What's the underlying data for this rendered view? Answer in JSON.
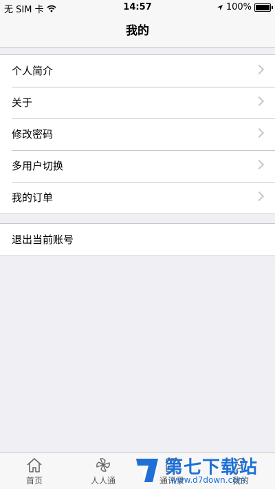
{
  "status_bar": {
    "carrier": "无 SIM 卡",
    "time": "14:57",
    "battery": "100%"
  },
  "nav": {
    "title": "我的"
  },
  "menu_items": [
    {
      "label": "个人简介"
    },
    {
      "label": "关于"
    },
    {
      "label": "修改密码"
    },
    {
      "label": "多用户切换"
    },
    {
      "label": "我的订单"
    }
  ],
  "logout": {
    "label": "退出当前账号"
  },
  "tabs": [
    {
      "label": "首页",
      "icon": "home-icon"
    },
    {
      "label": "人人通",
      "icon": "pinwheel-icon"
    },
    {
      "label": "通讯录",
      "icon": "contacts-icon"
    },
    {
      "label": "我的",
      "icon": "profile-icon"
    }
  ],
  "watermark": {
    "text": "第七下载站",
    "url": "www.d7down.com"
  },
  "colors": {
    "background": "#efeff4",
    "bar": "#f7f7f7",
    "separator": "#c8c7cc",
    "chevron": "#c7c7cc",
    "watermark": "#1e6fd6"
  }
}
